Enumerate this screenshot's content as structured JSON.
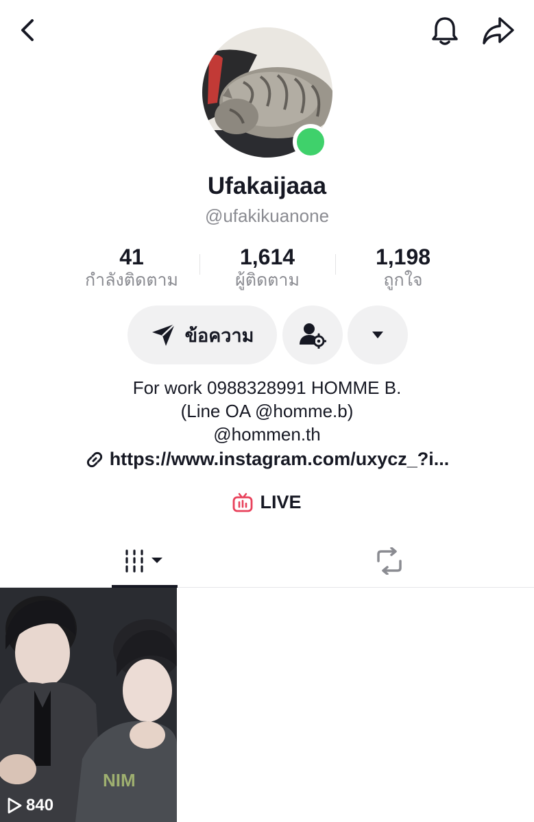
{
  "profile": {
    "display_name": "Ufakaijaaa",
    "handle": "@ufakikuanone"
  },
  "stats": {
    "following": {
      "value": "41",
      "label": "กำลังติดตาม"
    },
    "followers": {
      "value": "1,614",
      "label": "ผู้ติดตาม"
    },
    "likes": {
      "value": "1,198",
      "label": "ถูกใจ"
    }
  },
  "actions": {
    "message_label": "ข้อความ"
  },
  "bio": {
    "line1": "For work 0988328991 HOMME B.",
    "line2": "(Line OA @homme.b)",
    "line3": "@hommen.th"
  },
  "link": {
    "text": "https://www.instagram.com/uxycz_?i..."
  },
  "live": {
    "label": "LIVE"
  },
  "videos": [
    {
      "views": "840"
    }
  ],
  "colors": {
    "online": "#3fd16b",
    "live_icon": "#e8405a",
    "text_primary": "#161823",
    "text_secondary": "#8a8b91"
  },
  "icons": [
    "back-icon",
    "bell-icon",
    "share-icon",
    "send-icon",
    "friend-settings-icon",
    "caret-down-icon",
    "link-icon",
    "live-tv-icon",
    "videos-grid-icon",
    "repost-icon",
    "play-icon"
  ]
}
